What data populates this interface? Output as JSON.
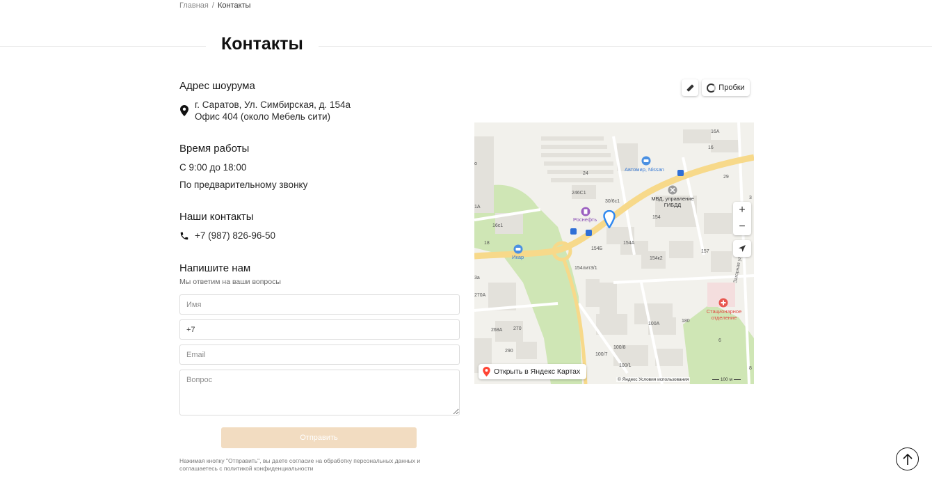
{
  "breadcrumb": {
    "home": "Главная",
    "separator": "/",
    "current": "Контакты"
  },
  "page_title": "Контакты",
  "showroom": {
    "heading": "Адрес шоурума",
    "address_line1": "г. Саратов, Ул. Симбирская, д. 154а",
    "address_line2": "Офис 404 (около Мебель сити)",
    "icon": "map-pin-icon"
  },
  "hours": {
    "heading": "Время работы",
    "line1": "С 9:00 до 18:00",
    "line2": "По предварительному звонку"
  },
  "contacts": {
    "heading": "Наши контакты",
    "phone": "+7 (987) 826-96-50",
    "icon": "phone-icon"
  },
  "form": {
    "heading": "Напишите нам",
    "subheading": "Мы ответим на ваши вопросы",
    "name_placeholder": "Имя",
    "phone_value": "+7",
    "email_placeholder": "Email",
    "question_placeholder": "Вопрос",
    "submit_label": "Отправить",
    "consent": "Нажимая кнопку \"Отправить\", вы даете согласие на обработку персональных данных и соглашаетесь с политикой конфиденциальности"
  },
  "map": {
    "traffic_label": "Пробки",
    "zoom_in": "+",
    "zoom_out": "−",
    "open_label": "Открыть в Яндекс Картах",
    "copyright": "© Яндекс   Условия использования",
    "scale": "100 м",
    "pois": {
      "avtomir": "Автомир, Nissan",
      "mvd": "МВД, управление ГИБДД",
      "rosneft": "Роснефть",
      "ikar": "Икар",
      "hospital": "Стационарное отделение",
      "street": "Загорная ул."
    },
    "buildings": [
      "16А",
      "16",
      "24",
      "246С1",
      "30/6с1",
      "154",
      "154А",
      "154к2",
      "157",
      "154лит3/1",
      "154Б",
      "16с1",
      "18",
      "270А",
      "268А",
      "270",
      "290",
      "100А",
      "100/8",
      "100/7",
      "100/1",
      "180",
      "6",
      "29",
      "3",
      "1А",
      "о",
      "3а",
      "8"
    ],
    "accent_color": "#4a90e2"
  },
  "colors": {
    "submit_bg": "#f2dcc1",
    "road": "#f7d98a",
    "park": "#cfe6b5"
  }
}
